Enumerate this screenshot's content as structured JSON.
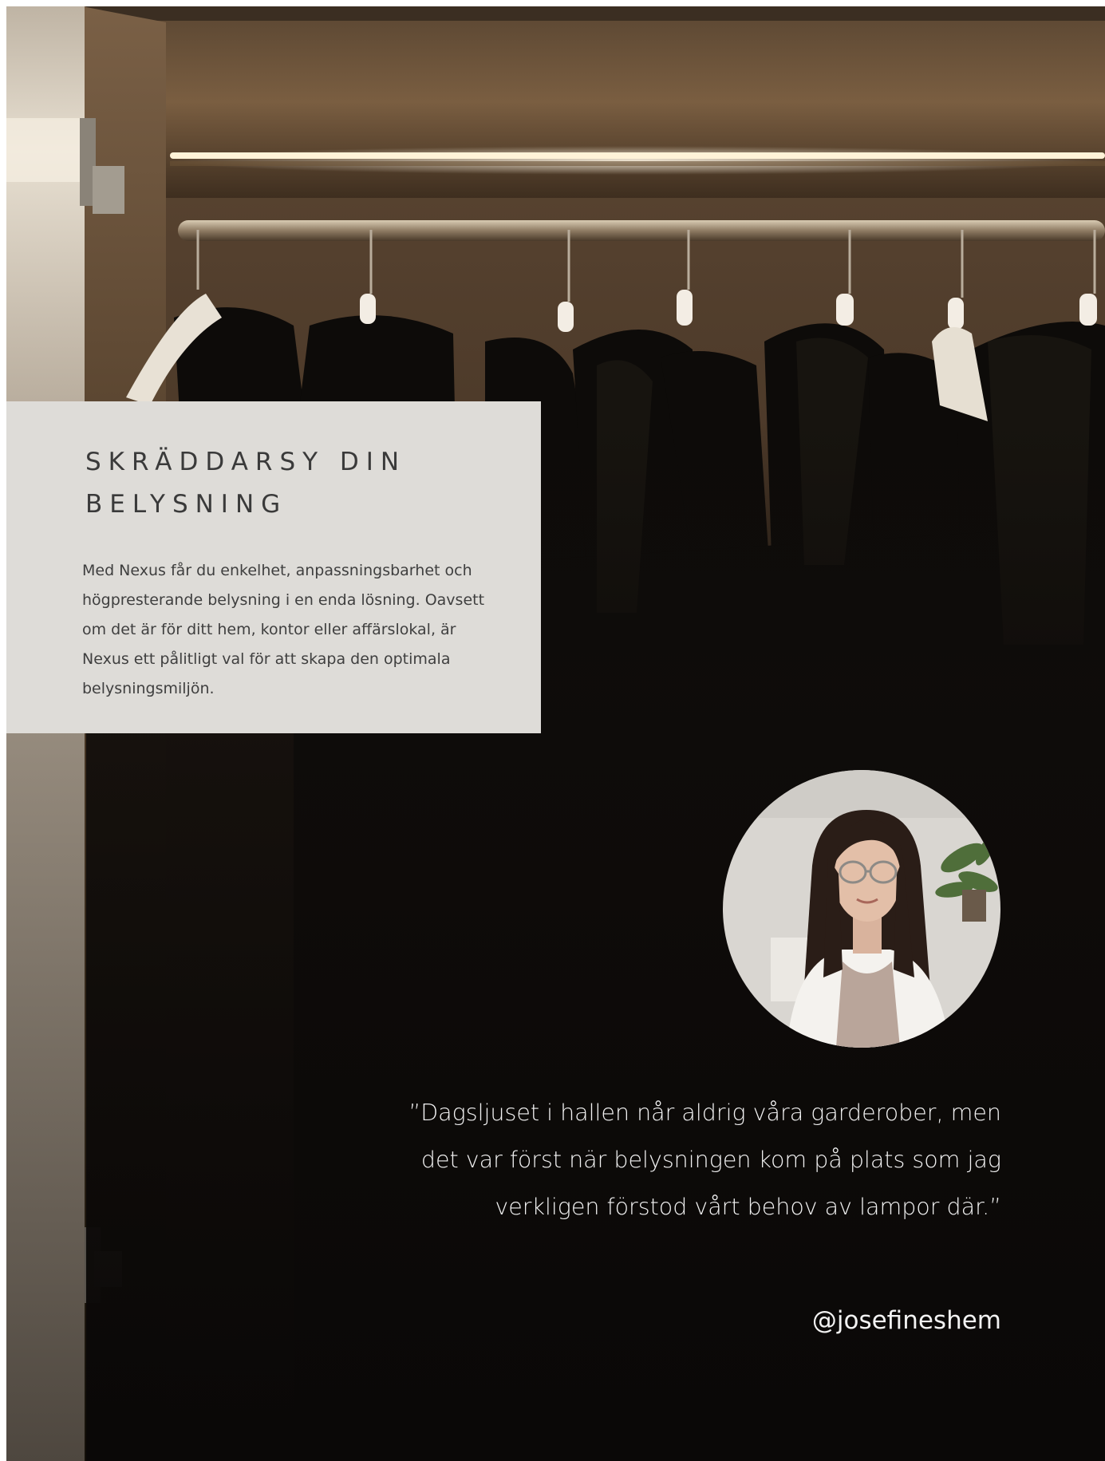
{
  "info_panel": {
    "title": "SKRÄDDARSY DIN BELYSNING",
    "body": "Med Nexus får du enkelhet, anpassningsbarhet och högpresterande belysning i en enda lösning. Oavsett om det är för ditt hem, kontor eller affärslokal, är Nexus ett pålitligt val för att skapa den optimala belysningsmiljön."
  },
  "testimonial": {
    "quote": "”Dagsljuset i hallen når aldrig våra garderober, men det var först när belysningen kom på plats som jag verkligen förstod vårt behov av lampor där.”",
    "handle": "@josefineshem"
  },
  "colors": {
    "panel_bg": "#dedcd8",
    "panel_text": "#3a3a3a",
    "dark_bg": "#0f0c0a",
    "quote_text": "#f2f2f2",
    "led_light": "#fff3d8",
    "wood": "#6b5136"
  }
}
